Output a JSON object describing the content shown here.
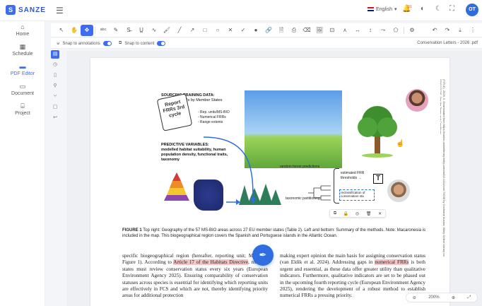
{
  "app": {
    "logo_mark": "S",
    "logo_text": "SANZE"
  },
  "topbar": {
    "language": "English",
    "notification_count": "31",
    "user_initials": "OT"
  },
  "sidebar": {
    "items": [
      {
        "label": "Home",
        "icon": "home-icon"
      },
      {
        "label": "Schedule",
        "icon": "calendar-icon"
      },
      {
        "label": "PDF Editor",
        "icon": "pdf-icon",
        "active": true
      },
      {
        "label": "Document",
        "icon": "folder-icon"
      },
      {
        "label": "Project",
        "icon": "briefcase-icon"
      }
    ]
  },
  "snapbar": {
    "snap_annotations": "Snap to annotations",
    "snap_content": "Snap to content",
    "filename": "Conservation Letters - 2026 .pdf"
  },
  "figure": {
    "heading1": "SOURCING TRAINING DATA:",
    "heading1b": "Numerical FRRs by Member States",
    "card_text": "Report FRRs 3rd cycle",
    "list1": "- Rep. units/MS-BIO",
    "list2": "- Numerical FRRs",
    "list3": "- Range extents",
    "heading2": "PREDICTIVE VARIABLES:",
    "heading2_lines": "modelled habitat suitability, human population density, functional traits, taxonomy",
    "rf_label": "random forest predictions",
    "tax_label": "taxonomic partitioning",
    "estimated": "estimated FRR thresholds →",
    "reclass": "reclassification of conservation sta",
    "text_tool": "T"
  },
  "caption": {
    "label": "FIGURE 1",
    "text": "Top right: Geography of the 57 MS-BIO areas across 27 EU member states (Table 2). Left and bottom: Summary of the methods. Note: Macaronesia is included in the map. This biogeographical region covers the Spanish and Portuguese islands in the Atlantic Ocean."
  },
  "body": {
    "left_col": "specific biogeographical region (hereafter, reporting unit; MS-BIO; Figure 1). According to Article 17 of the Habitats Directive, member states must review conservation status every six years (European Environment Agency 2025). Ensuring comparability of conservation statuses across species is essential for identifying which reporting units are effectively in FCS and which are not, thereby identifying priority areas for additional protection",
    "right_col": "making expert opinion the main basis for assigning conservation status (van Eldik et al. 2024). Addressing gaps in numerical FRRs is both urgent and essential, as these data offer greater utility than qualitative indicators. Furthermore, qualitative indicators are set to be phased out in the upcoming fourth reporting cycle (European Environment Agency 2025), rendering the development of a robust method to establish numerical FRRs a pressing priority."
  },
  "margin_text": "(TITLE), 2026, 0. Downloaded from https://conbio.onlinelibrary.wiley.com/doi/10.1111/conl.70038 by Cochrane Austria, Wiley Online Library on [05/01/2026]. See the Terms and Conditions",
  "zoom": {
    "level": "200%"
  },
  "colors": {
    "accent": "#3d6cf0",
    "highlight": "#f6c4c4"
  }
}
